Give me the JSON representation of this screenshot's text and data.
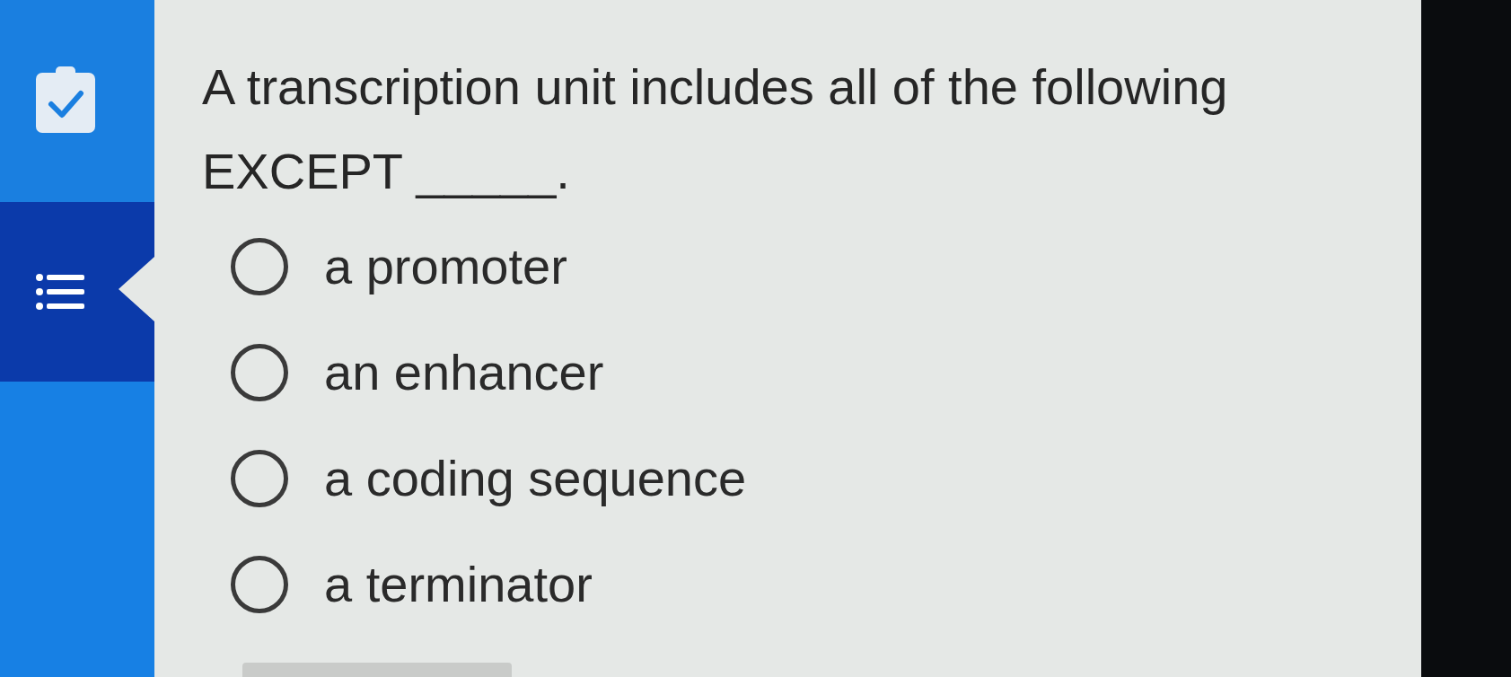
{
  "sidebar": {
    "items": [
      {
        "kind": "clipboard",
        "selected": false
      },
      {
        "kind": "list",
        "selected": true
      }
    ]
  },
  "question": {
    "text": "A transcription unit includes all of the following EXCEPT _____."
  },
  "options": [
    {
      "label": "a promoter",
      "selected": false
    },
    {
      "label": "an enhancer",
      "selected": false
    },
    {
      "label": "a coding sequence",
      "selected": false
    },
    {
      "label": "a terminator",
      "selected": false
    }
  ]
}
